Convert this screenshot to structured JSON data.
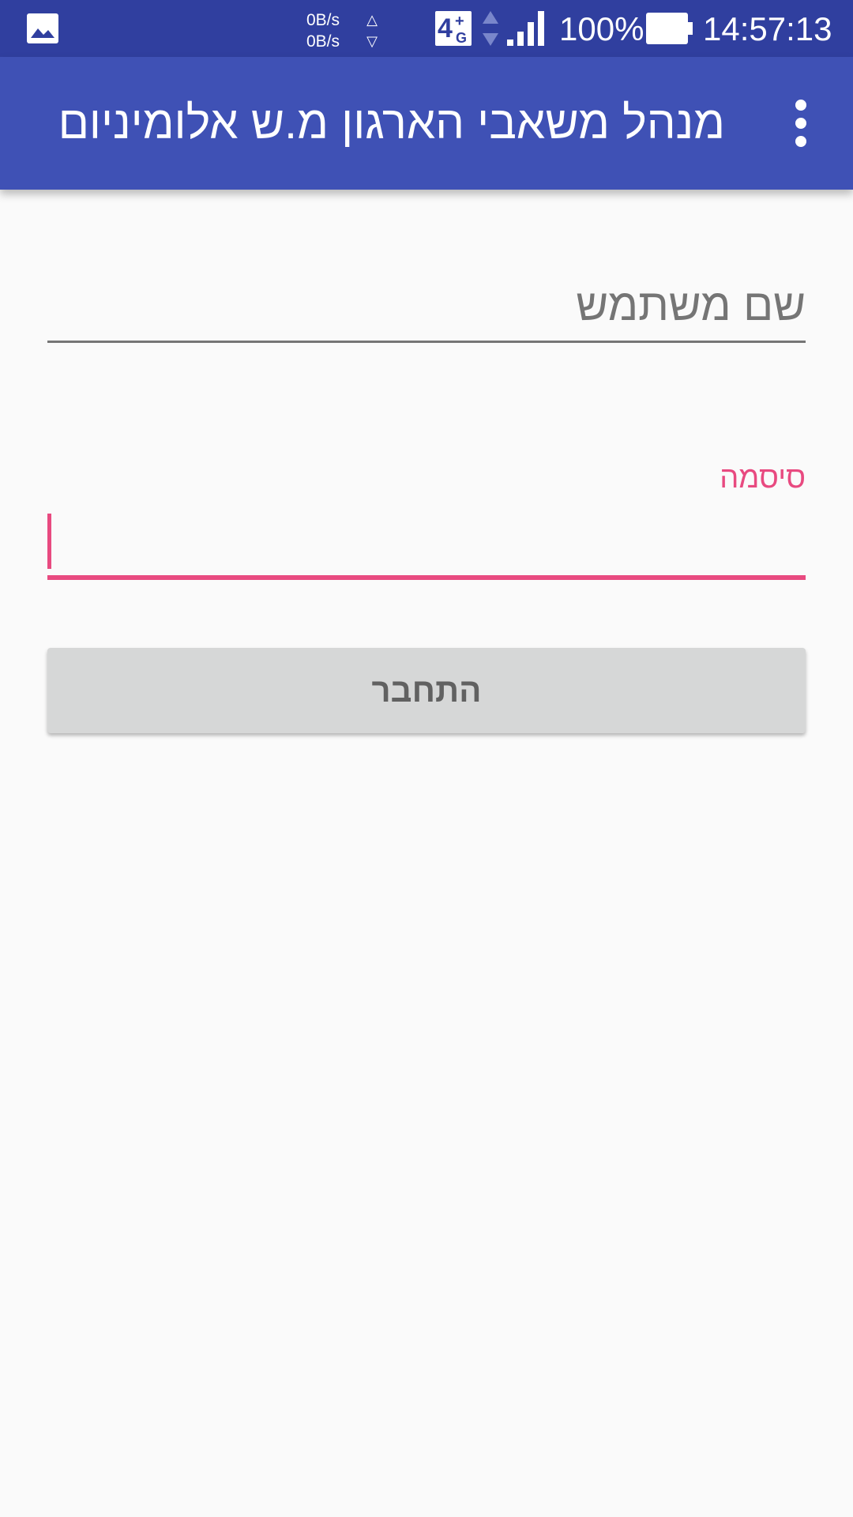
{
  "status_bar": {
    "icons": {
      "notification": "image-icon",
      "network_type": "4g-plus-icon",
      "data_activity": "updown-arrows-icon",
      "signal": "signal-bars-icon",
      "battery": "battery-full-icon"
    },
    "net_speed_up": "0B/s",
    "net_speed_down": "0B/s",
    "net_up_arrow": "△",
    "net_down_arrow": "▽",
    "network_digit": "4",
    "network_plus": "+",
    "network_g": "G",
    "battery_percent": "100%",
    "time": "14:57:13"
  },
  "app_bar": {
    "title": "מנהל משאבי הארגון מ.ש אלומיניום",
    "menu_icon": "more-vert-icon"
  },
  "form": {
    "username_placeholder": "שם משתמש",
    "username_value": "",
    "password_label": "סיסמה",
    "password_value": "",
    "login_label": "התחבר"
  },
  "colors": {
    "status_bar": "#303f9f",
    "app_bar": "#3f51b5",
    "accent": "#e84a80",
    "background": "#fafafa",
    "button": "#d6d7d7"
  }
}
